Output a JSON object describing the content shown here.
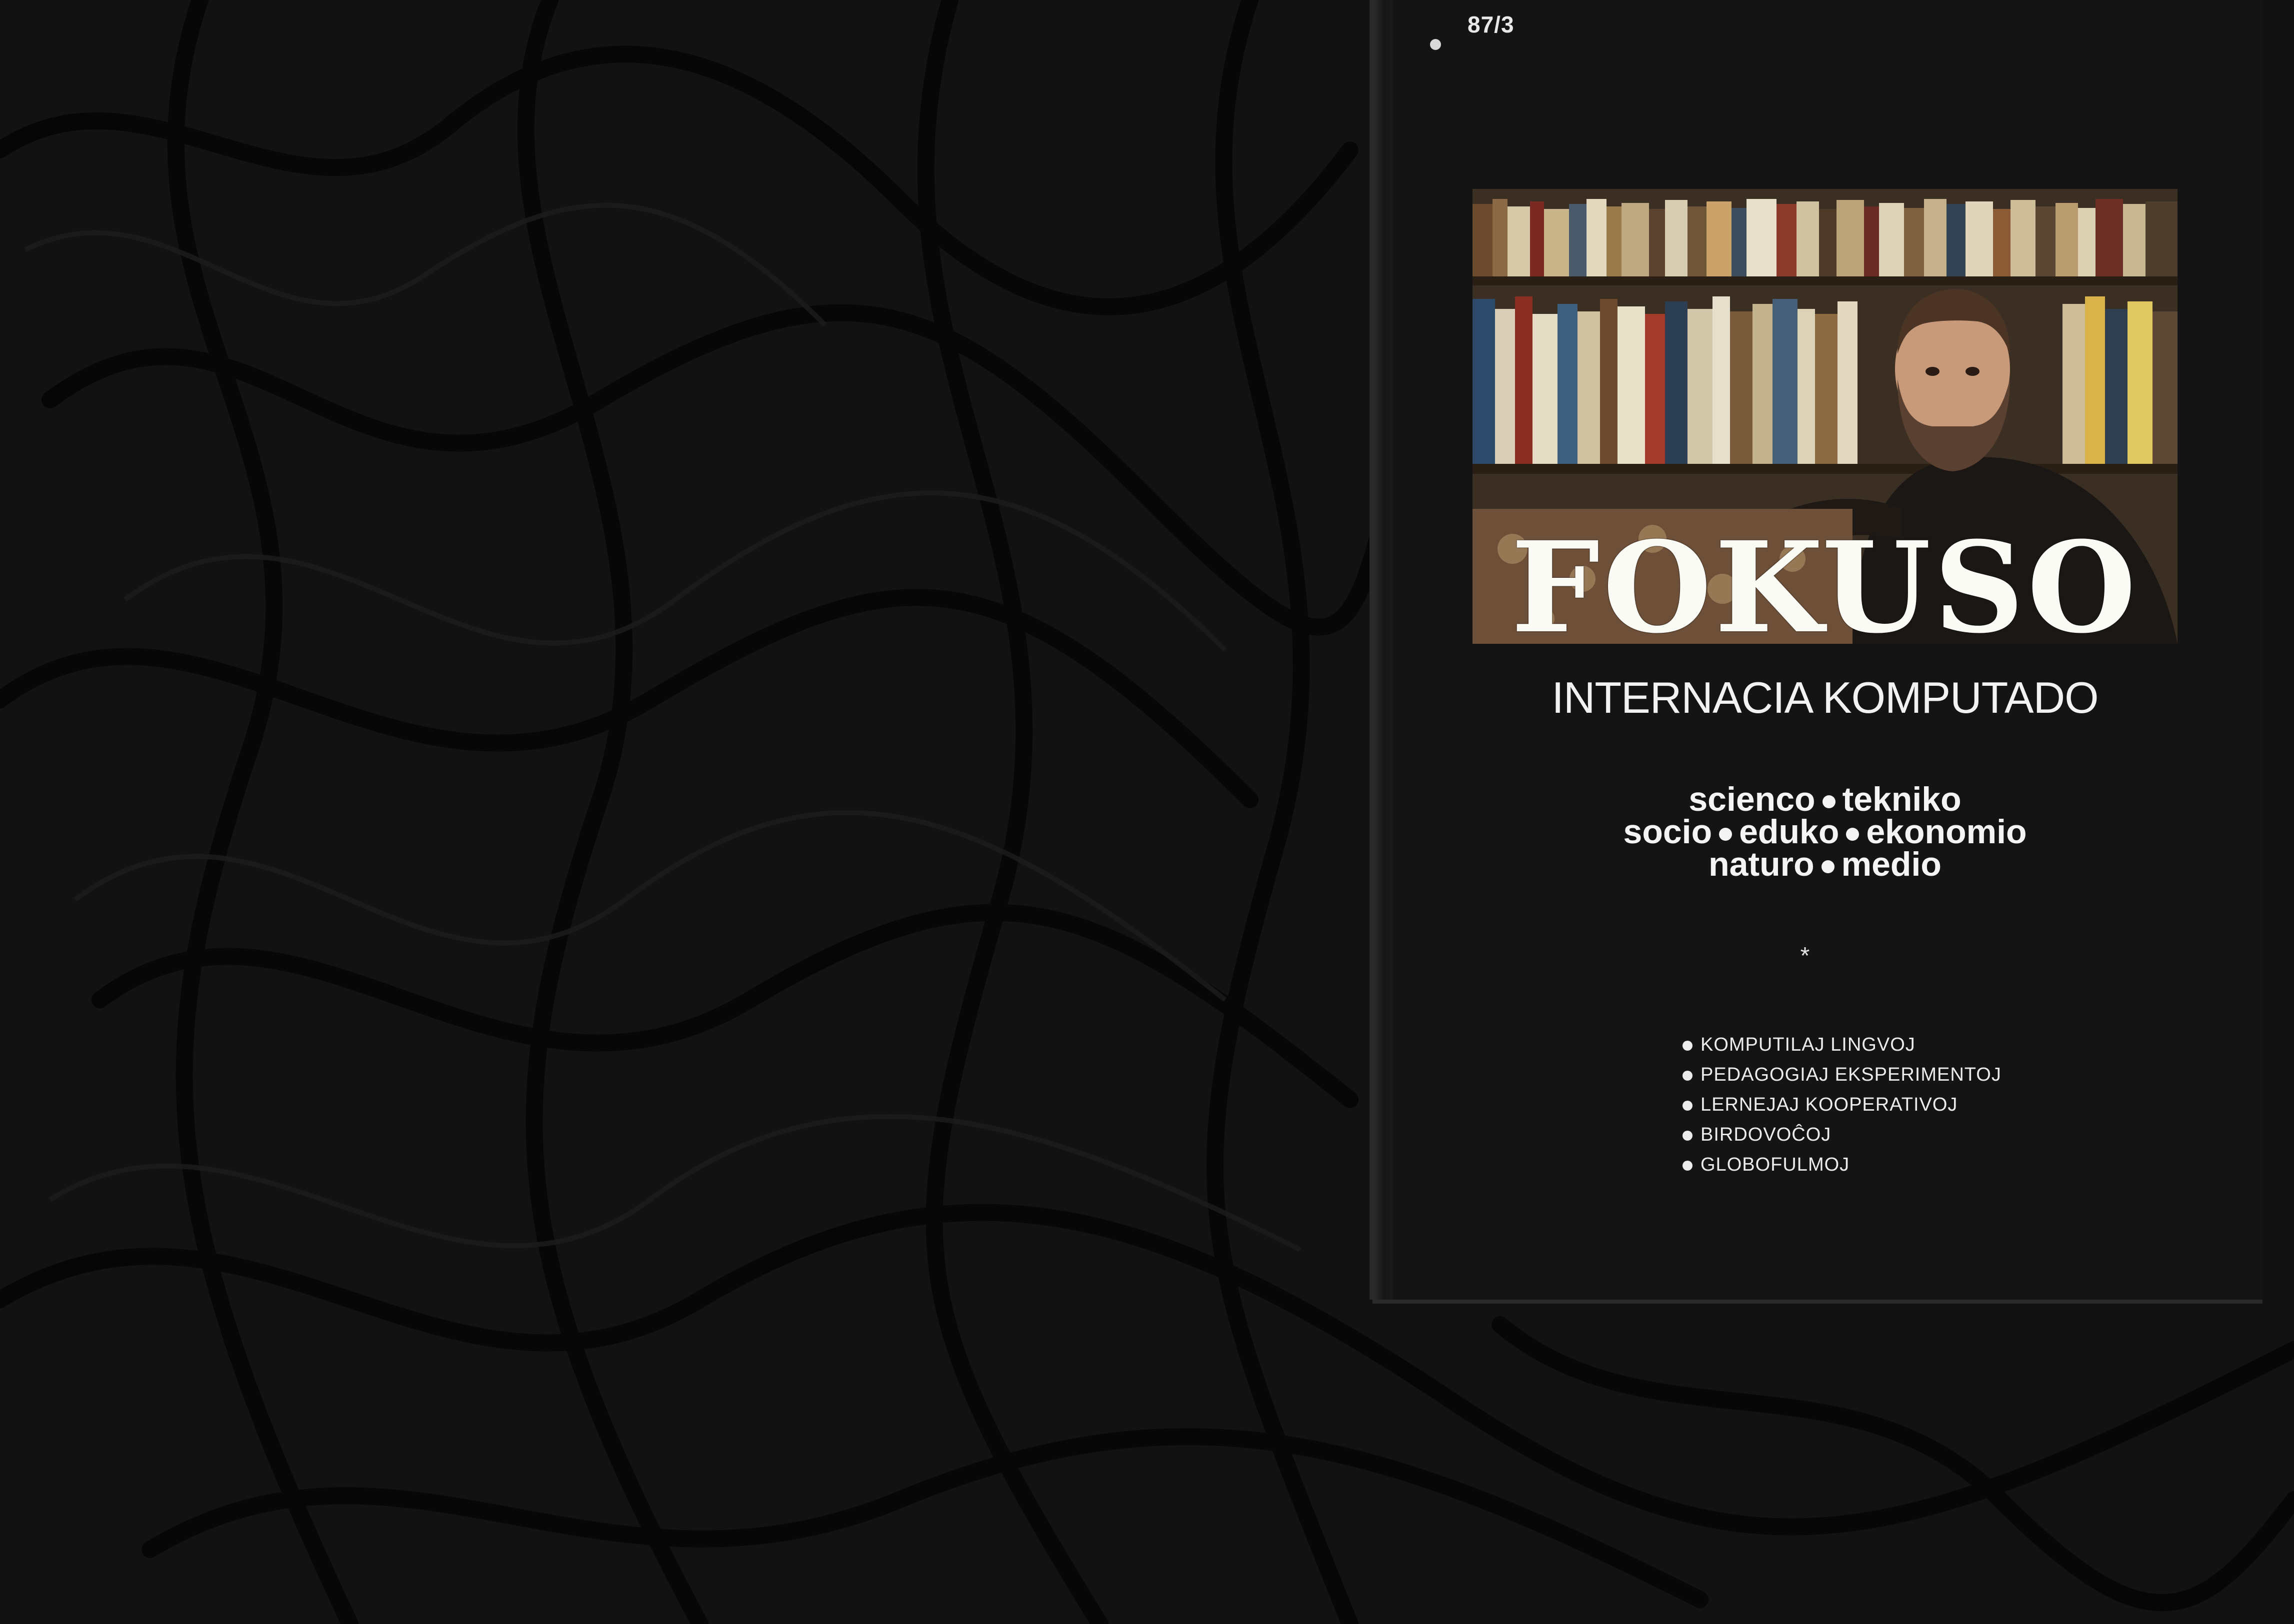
{
  "magazine": {
    "issue": "87/3",
    "title": "FOKUSO",
    "subtitle": "INTERNACIA KOMPUTADO",
    "topics": {
      "line1": [
        "scienco",
        "tekniko"
      ],
      "line2": [
        "socio",
        "eduko",
        "ekonomio"
      ],
      "line3": [
        "naturo",
        "medio"
      ]
    },
    "separator": "*",
    "features": [
      "KOMPUTILAJ LINGVOJ",
      "PEDAGOGIAJ EKSPERIMENTOJ",
      "LERNEJAJ KOOPERATIVOJ",
      "BIRDOVOĈOJ",
      "GLOBOFULMOJ"
    ]
  },
  "colors": {
    "background_fabric": "#111111",
    "cover": "#141414",
    "text": "#f2f2f2"
  }
}
